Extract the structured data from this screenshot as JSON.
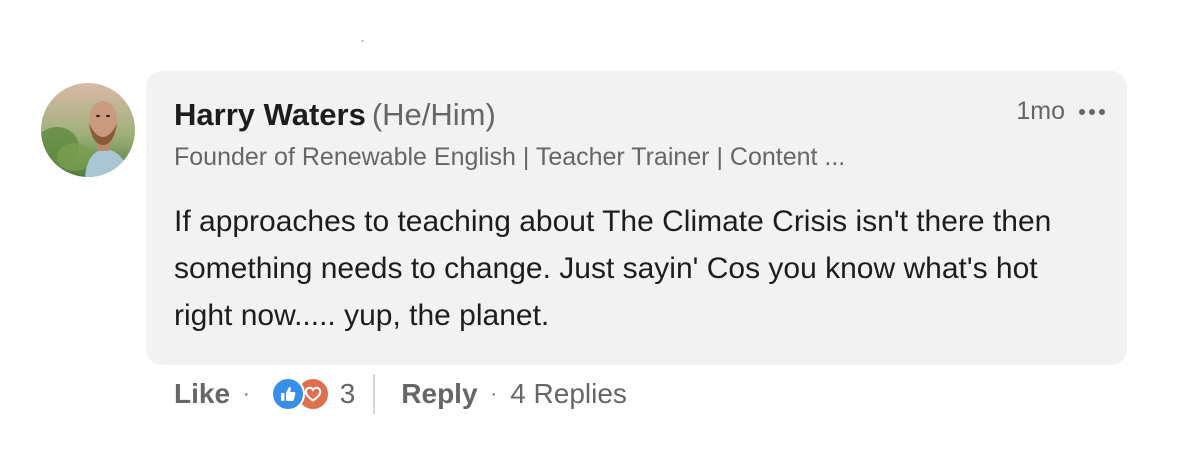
{
  "comment": {
    "author_name": "Harry Waters",
    "author_pronouns": "(He/Him)",
    "author_headline": "Founder of Renewable English | Teacher Trainer | Content ...",
    "timestamp": "1mo",
    "more_icon": "ellipsis-icon",
    "avatar_icon": "profile-photo",
    "text": "If approaches to teaching about The Climate Crisis isn't there then something needs to change. Just sayin' Cos you know what's hot right now..... yup, the planet."
  },
  "actions": {
    "like_label": "Like",
    "separator": "·",
    "reaction_icons": [
      "like-icon",
      "love-icon"
    ],
    "reaction_count": "3",
    "reply_label": "Reply",
    "replies_label": "4 Replies"
  },
  "colors": {
    "bubble_bg": "#f2f2f2",
    "primary_text": "#1d1d1d",
    "secondary_text": "#666666",
    "like_blue": "#378fe9",
    "love_orange": "#df704d"
  }
}
